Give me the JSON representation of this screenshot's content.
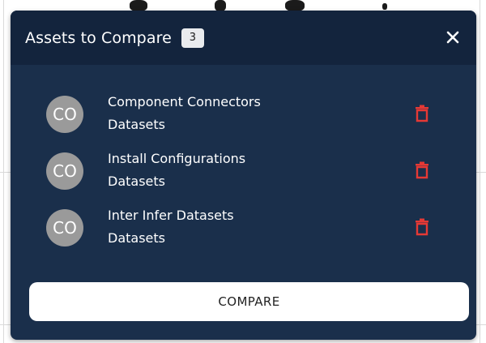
{
  "panel": {
    "title": "Assets to Compare",
    "count": "3",
    "close_icon": "close-icon"
  },
  "assets": [
    {
      "avatar": "CO",
      "name": "Component Connectors",
      "type": "Datasets",
      "delete_icon": "trash-icon"
    },
    {
      "avatar": "CO",
      "name": "Install Configurations",
      "type": "Datasets",
      "delete_icon": "trash-icon"
    },
    {
      "avatar": "CO",
      "name": "Inter Infer Datasets",
      "type": "Datasets",
      "delete_icon": "trash-icon"
    }
  ],
  "actions": {
    "compare_label": "COMPARE"
  },
  "colors": {
    "panel_bg": "#1a2f4b",
    "header_bg": "#13243d",
    "delete_red": "#e53935",
    "avatar_bg": "#9a9a9a"
  }
}
